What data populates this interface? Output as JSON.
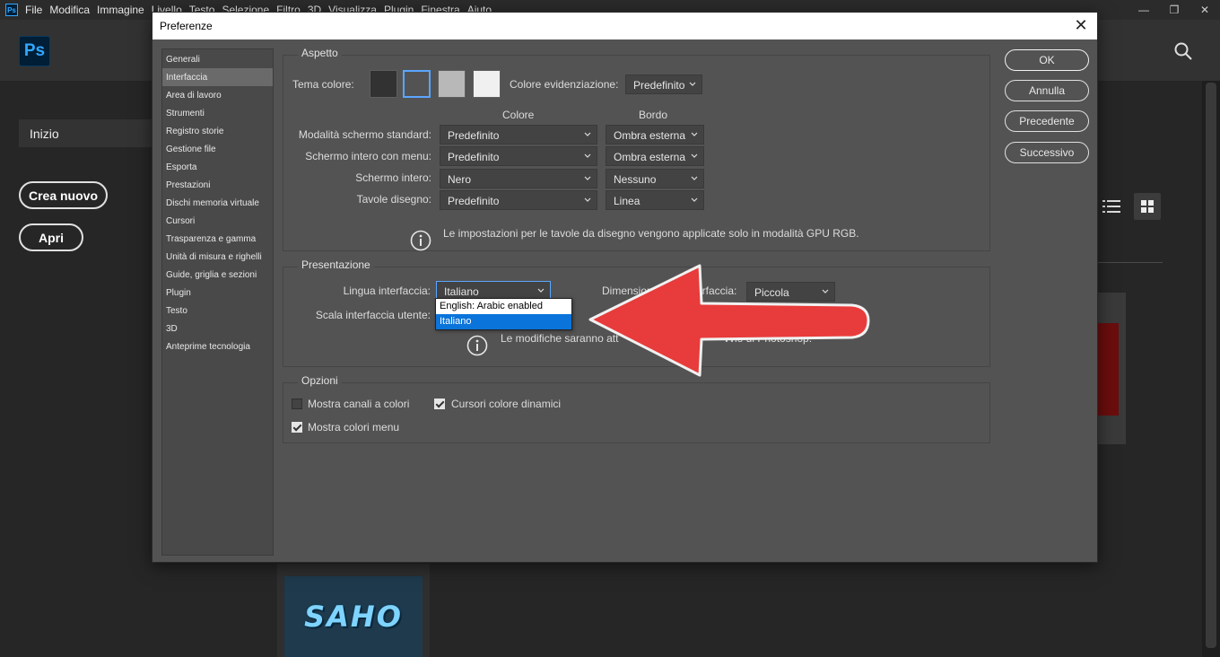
{
  "app": {
    "badge": "Ps",
    "menu": [
      "File",
      "Modifica",
      "Immagine",
      "Livello",
      "Testo",
      "Selezione",
      "Filtro",
      "3D",
      "Visualizza",
      "Plugin",
      "Finestra",
      "Aiuto"
    ],
    "window_buttons": {
      "minimize": "—",
      "restore": "❐",
      "close": "✕"
    },
    "logo": "Ps",
    "home": {
      "nav_home": "Inizio",
      "create_new": "Crea nuovo",
      "open": "Apri",
      "thumbnail_text": "SAHO"
    }
  },
  "dialog": {
    "title": "Preferenze",
    "close": "✕",
    "categories": [
      "Generali",
      "Interfaccia",
      "Area di lavoro",
      "Strumenti",
      "Registro storie",
      "Gestione file",
      "Esporta",
      "Prestazioni",
      "Dischi memoria virtuale",
      "Cursori",
      "Trasparenza e gamma",
      "Unità di misura e righelli",
      "Guide, griglia e sezioni",
      "Plugin",
      "Testo",
      "3D",
      "Anteprime tecnologia"
    ],
    "selected_category": "Interfaccia",
    "buttons": {
      "ok": "OK",
      "cancel": "Annulla",
      "prev": "Precedente",
      "next": "Successivo"
    },
    "aspetto": {
      "title": "Aspetto",
      "theme_label": "Tema colore:",
      "highlight_label": "Colore evidenziazione:",
      "highlight_value": "Predefinito",
      "col_color": "Colore",
      "col_border": "Bordo",
      "rows": [
        {
          "label": "Modalità schermo standard:",
          "color": "Predefinito",
          "border": "Ombra esterna"
        },
        {
          "label": "Schermo intero con menu:",
          "color": "Predefinito",
          "border": "Ombra esterna"
        },
        {
          "label": "Schermo intero:",
          "color": "Nero",
          "border": "Nessuno"
        },
        {
          "label": "Tavole disegno:",
          "color": "Predefinito",
          "border": "Linea"
        }
      ],
      "note": "Le impostazioni per le tavole da disegno vengono applicate solo in modalità GPU RGB."
    },
    "presentazione": {
      "title": "Presentazione",
      "lang_label": "Lingua interfaccia:",
      "lang_value": "Italiano",
      "size_label_a": "Dimension",
      "size_label_b": "erfaccia:",
      "size_value": "Piccola",
      "scale_label": "Scala interfaccia utente:",
      "note_a": "Le modifiche saranno att",
      "note_b": "vvio di Photoshop.",
      "lang_options": [
        "English: Arabic enabled",
        "Italiano"
      ]
    },
    "opzioni": {
      "title": "Opzioni",
      "show_channels": "Mostra canali a colori",
      "dynamic_sliders": "Cursori colore dinamici",
      "menu_colors": "Mostra colori menu"
    }
  },
  "colors": {
    "accent": "#5aa6ff",
    "highlight": "#0a74da",
    "arrow": "#e83b3b"
  }
}
